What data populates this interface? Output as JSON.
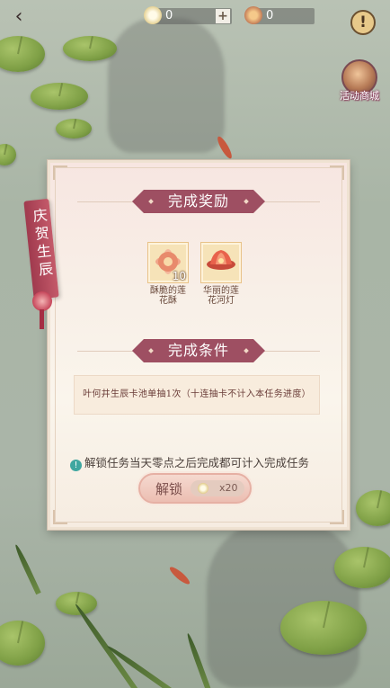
{
  "topbar": {
    "currency1": {
      "icon": "lotus-coin-icon",
      "value": "0"
    },
    "currency2": {
      "icon": "cake-icon",
      "value": "0"
    },
    "plus_label": "+",
    "help_label": "!"
  },
  "shop": {
    "label": "活动商城",
    "icon": "shop-icon"
  },
  "ribbon": {
    "text": "庆贺生辰"
  },
  "dialog": {
    "rewards_title": "完成奖励",
    "rewards": [
      {
        "name": "酥脆的莲花酥",
        "count": "10",
        "icon": "lotus-pastry-icon"
      },
      {
        "name": "华丽的莲花河灯",
        "count": "",
        "icon": "lotus-lantern-icon"
      }
    ],
    "conditions_title": "完成条件",
    "condition_text": "叶何井生辰卡池单抽1次（十连抽卡不计入本任务进度）",
    "notice": "解锁任务当天零点之后完成都可计入完成任务",
    "unlock_label": "解锁",
    "unlock_cost": "x20"
  },
  "colors": {
    "banner": "#9e4f62",
    "ribbon": "#a03a4e",
    "info": "#3fa7a0",
    "dialog_bg": "#f8efe7"
  }
}
